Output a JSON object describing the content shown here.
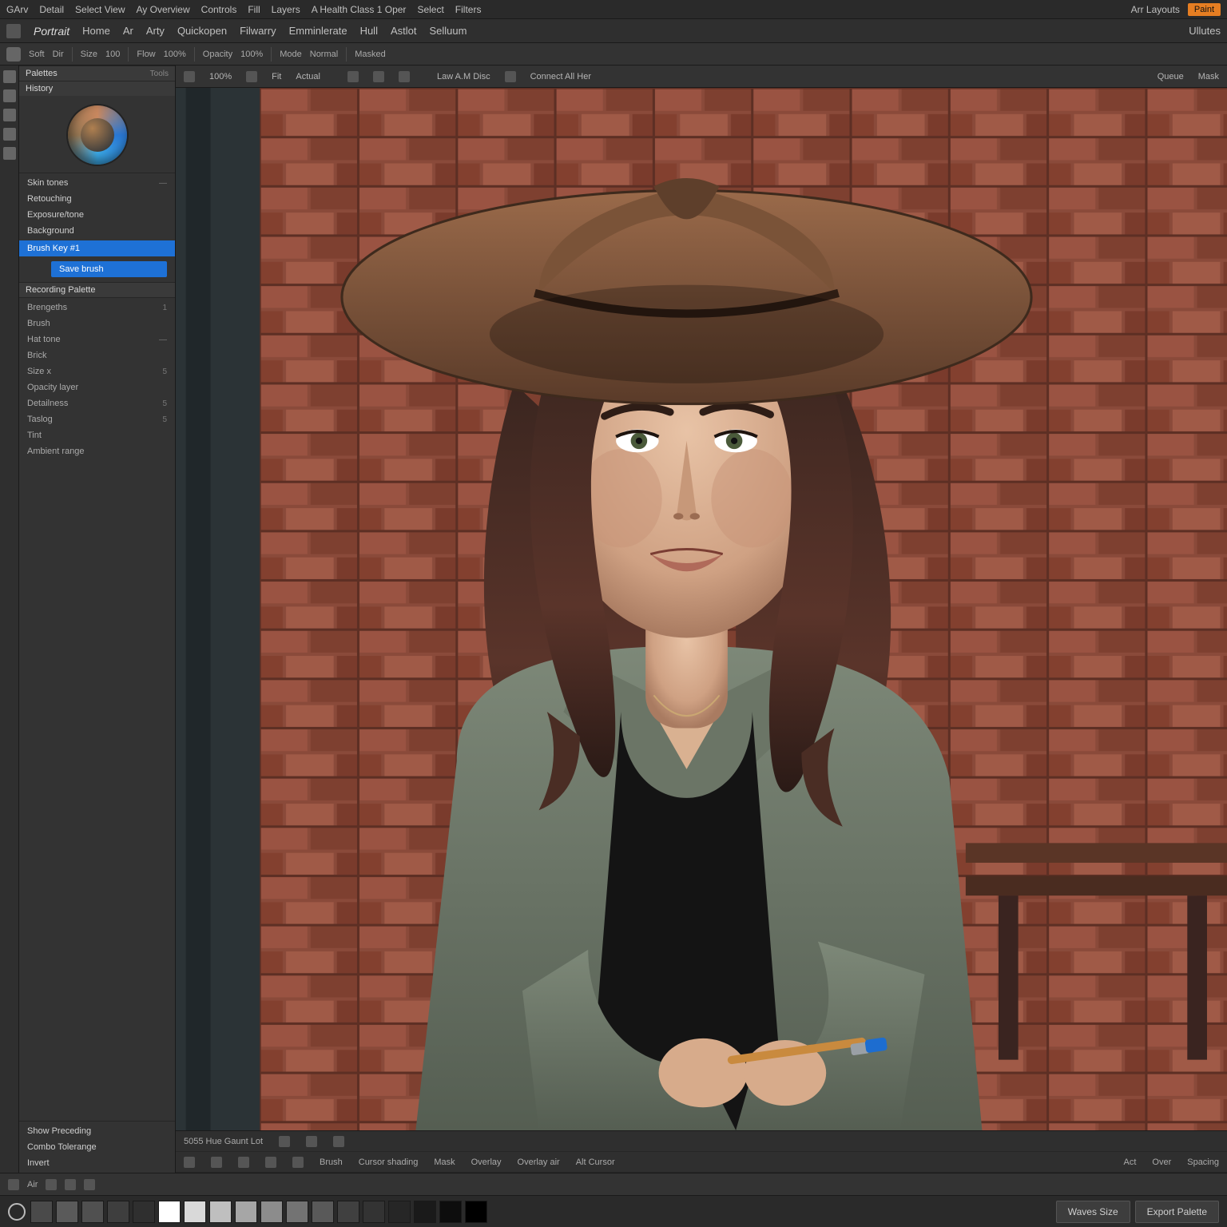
{
  "menubar": {
    "items": [
      "GArv",
      "Detail",
      "Select View",
      "Ay Overview",
      "Controls",
      "Fill",
      "Layers",
      "A Health Class 1 Oper",
      "Select",
      "Filters"
    ],
    "right": {
      "layout_hint": "Arr Layouts",
      "pill": "Paint"
    }
  },
  "menubar2": {
    "doc_name": "Portrait",
    "items": [
      "Home",
      "Ar",
      "Arty",
      "Quickopen",
      "Filwarry",
      "Emminlerate",
      "Hull",
      "Astlot",
      "Selluum"
    ],
    "right_label": "Ullutes"
  },
  "optbar": {
    "items": [
      "Soft",
      "Dir",
      "Size",
      "100",
      "Flow",
      "100%",
      "Opacity",
      "100%",
      "Mode",
      "Normal",
      "Masked"
    ]
  },
  "sidebar": {
    "top_panel": {
      "title": "Palettes",
      "tab": "Tools"
    },
    "color_panel": {
      "title": "History"
    },
    "groups": [
      {
        "label": "Skin tones",
        "val": "—"
      },
      {
        "label": "Retouching",
        "val": ""
      },
      {
        "label": "Exposure/tone",
        "val": ""
      },
      {
        "label": "Background",
        "val": ""
      }
    ],
    "active_row": "Brush Key #1",
    "blue_btn": "Save brush",
    "heading2": "Recording Palette",
    "params": [
      {
        "label": "Brengeths",
        "val": "1"
      },
      {
        "label": "Brush",
        "val": ""
      },
      {
        "label": "Hat tone",
        "val": "—"
      },
      {
        "label": "Brick",
        "val": ""
      },
      {
        "label": "Size x",
        "val": "5"
      },
      {
        "label": "Opacity layer",
        "val": ""
      },
      {
        "label": "Detailness",
        "val": "5"
      },
      {
        "label": "Taslog",
        "val": "5"
      },
      {
        "label": "Tint",
        "val": ""
      },
      {
        "label": "Ambient range",
        "val": ""
      }
    ],
    "bottom": {
      "heading": "Show Preceding",
      "rows": [
        "Combo Tolerange",
        "Invert"
      ]
    }
  },
  "canvas_tabs": {
    "left": [
      "100%",
      "Fit",
      "Actual"
    ],
    "mid": [
      "Law A.M Disc",
      "Connect All Her"
    ],
    "right": [
      "Queue",
      "Mask"
    ]
  },
  "belowcanvas": {
    "row1_left": "5055 Hue Gaunt Lot",
    "row2_items": [
      "Brush",
      "Cursor shading",
      "Mask",
      "Overlay",
      "Overlay air",
      "Alt Cursor",
      "Act",
      "Over",
      "Spacing"
    ]
  },
  "status": {
    "left": "Air"
  },
  "swatches": [
    "#4a4a4a",
    "#5a5a5a",
    "#505050",
    "#3e3e3e",
    "#2f2f2f",
    "#ffffff",
    "#d9d9d9",
    "#bfbfbf",
    "#a6a6a6",
    "#8c8c8c",
    "#737373",
    "#595959",
    "#404040",
    "#333333",
    "#262626",
    "#1a1a1a",
    "#0d0d0d",
    "#000000"
  ],
  "footer_buttons": {
    "left": "Waves Size",
    "right": "Export Palette"
  }
}
